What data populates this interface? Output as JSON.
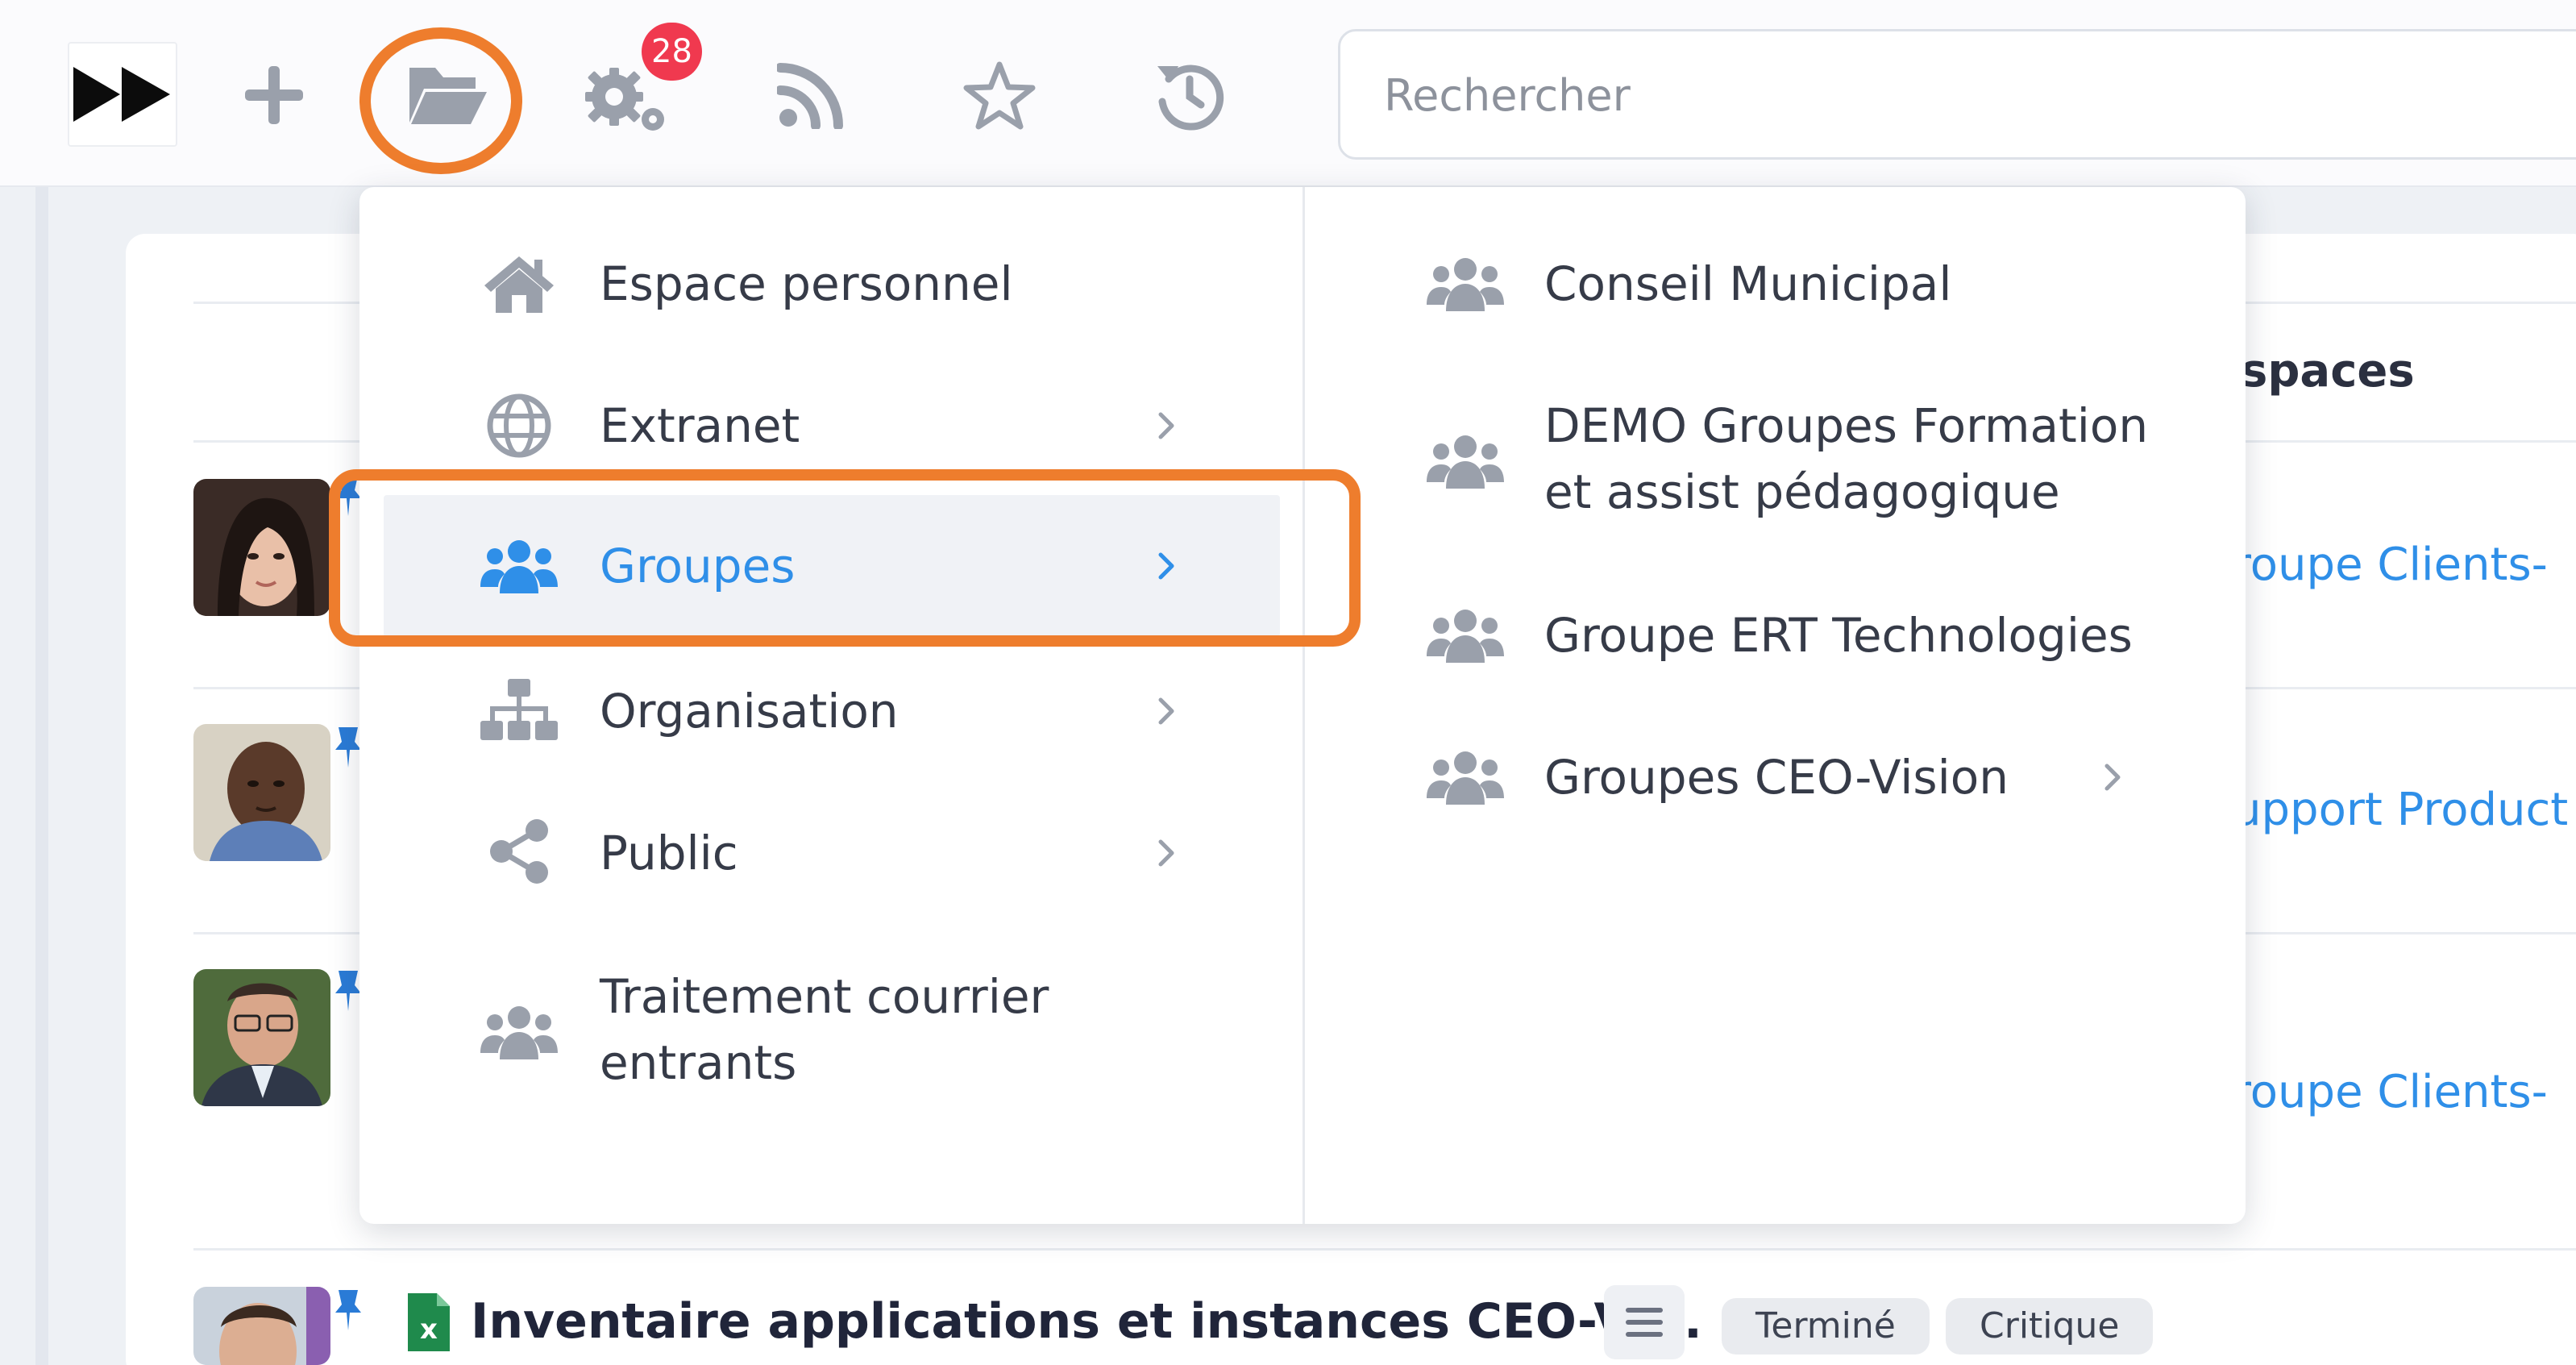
{
  "topbar": {
    "notification_count": "28",
    "search_placeholder": "Rechercher",
    "icons": [
      "fast-forward-icon",
      "plus-icon",
      "folder-open-icon",
      "gears-icon",
      "rss-icon",
      "star-icon",
      "history-icon"
    ]
  },
  "menu": {
    "left": [
      {
        "label": "Espace personnel",
        "icon": "home-icon",
        "has_submenu": false
      },
      {
        "label": "Extranet",
        "icon": "globe-icon",
        "has_submenu": true
      },
      {
        "label": "Groupes",
        "icon": "users-icon",
        "has_submenu": true,
        "active": true
      },
      {
        "label": "Organisation",
        "icon": "sitemap-icon",
        "has_submenu": true
      },
      {
        "label": "Public",
        "icon": "share-icon",
        "has_submenu": true
      },
      {
        "label": "Traitement courrier",
        "label_line2": "entrants",
        "icon": "users-icon",
        "has_submenu": false
      }
    ],
    "right": [
      {
        "label": "Conseil Municipal",
        "icon": "users-icon",
        "has_submenu": false
      },
      {
        "label": "DEMO Groupes Formation",
        "label_line2": "et assist pédagogique",
        "icon": "users-icon",
        "has_submenu": false
      },
      {
        "label": "Groupe ERT Technologies",
        "icon": "users-icon",
        "has_submenu": false
      },
      {
        "label": "Groupes CEO-Vision",
        "icon": "users-icon",
        "has_submenu": true
      }
    ]
  },
  "background": {
    "heading": "spaces",
    "links": [
      "roupe Clients-",
      "upport Product",
      "roupe Clients-"
    ],
    "task": {
      "title": "Inventaire applications et instances CEO-Vi...",
      "tags": [
        "Terminé",
        "Critique"
      ]
    }
  },
  "colors": {
    "accent": "#2f8fe8",
    "annotation": "#ee7d2d",
    "badge": "#f0394f",
    "icon_gray": "#9aa0ab"
  }
}
